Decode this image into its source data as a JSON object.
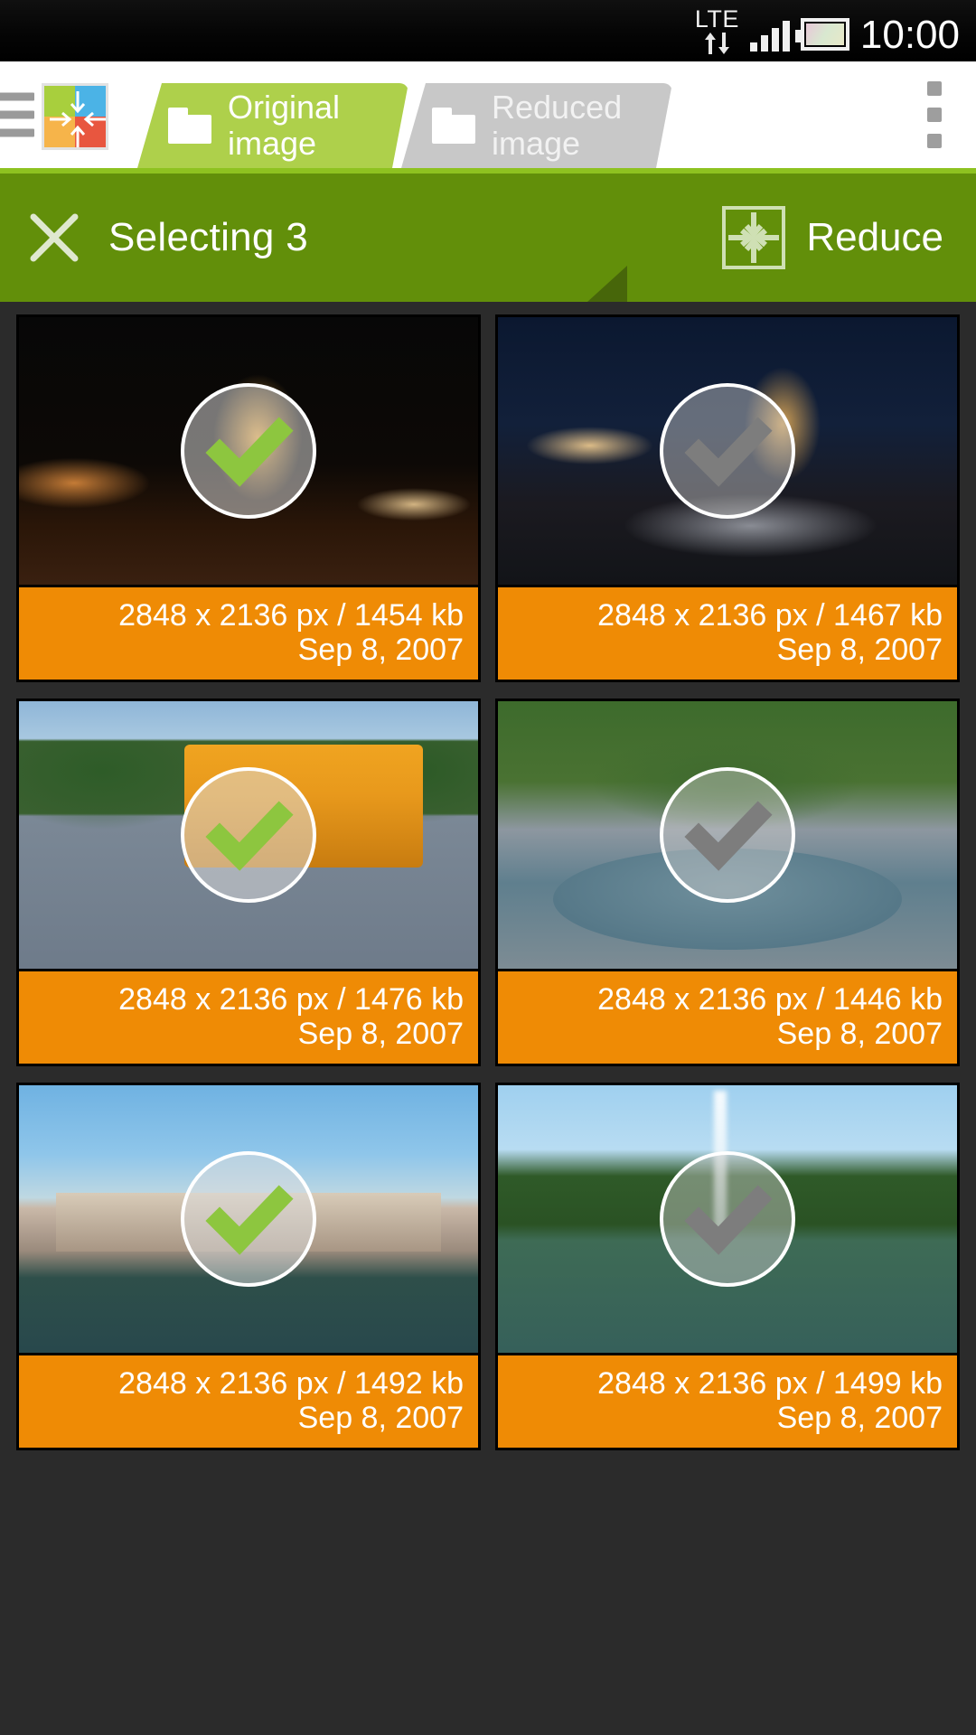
{
  "statusbar": {
    "network_label": "LTE",
    "clock": "10:00",
    "icons": [
      "data-up-arrow",
      "data-down-arrow",
      "signal-bars",
      "battery"
    ]
  },
  "titlebar": {
    "menu_icon": "hamburger-icon",
    "app_logo": "reduce-app-logo",
    "overflow_icon": "overflow-menu-icon",
    "tabs": [
      {
        "label_line1": "Original",
        "label_line2": "image",
        "active": true,
        "icon": "folder-icon"
      },
      {
        "label_line1": "Reduced",
        "label_line2": "image",
        "active": false,
        "icon": "folder-icon"
      }
    ]
  },
  "actionbar": {
    "close_icon": "close-x-icon",
    "title": "Selecting 3",
    "reduce_icon": "reduce-icon",
    "reduce_label": "Reduce",
    "bar_color": "#628f0a",
    "accent_color": "#8ec220"
  },
  "colors": {
    "tab_active": "#aed04b",
    "tab_inactive": "#c8c8c8",
    "caption_orange": "#ef8b05",
    "check_green": "#8dc63f",
    "check_gray": "#7d7d7d",
    "page_background": "#2b2b2b"
  },
  "grid": {
    "items": [
      {
        "art": "art-night1",
        "selected": true,
        "dimensions": "2848 x 2136 px / 1454 kb",
        "date": "Sep 8, 2007"
      },
      {
        "art": "art-night2",
        "selected": false,
        "dimensions": "2848 x 2136 px / 1467 kb",
        "date": "Sep 8, 2007"
      },
      {
        "art": "art-bus",
        "selected": true,
        "dimensions": "2848 x 2136 px / 1476 kb",
        "date": "Sep 8, 2007"
      },
      {
        "art": "art-fount1",
        "selected": false,
        "dimensions": "2848 x 2136 px / 1446 kb",
        "date": "Sep 8, 2007"
      },
      {
        "art": "art-palace",
        "selected": true,
        "dimensions": "2848 x 2136 px / 1492 kb",
        "date": "Sep 8, 2007"
      },
      {
        "art": "art-fount2",
        "selected": false,
        "dimensions": "2848 x 2136 px / 1499 kb",
        "date": "Sep 8, 2007"
      }
    ]
  }
}
